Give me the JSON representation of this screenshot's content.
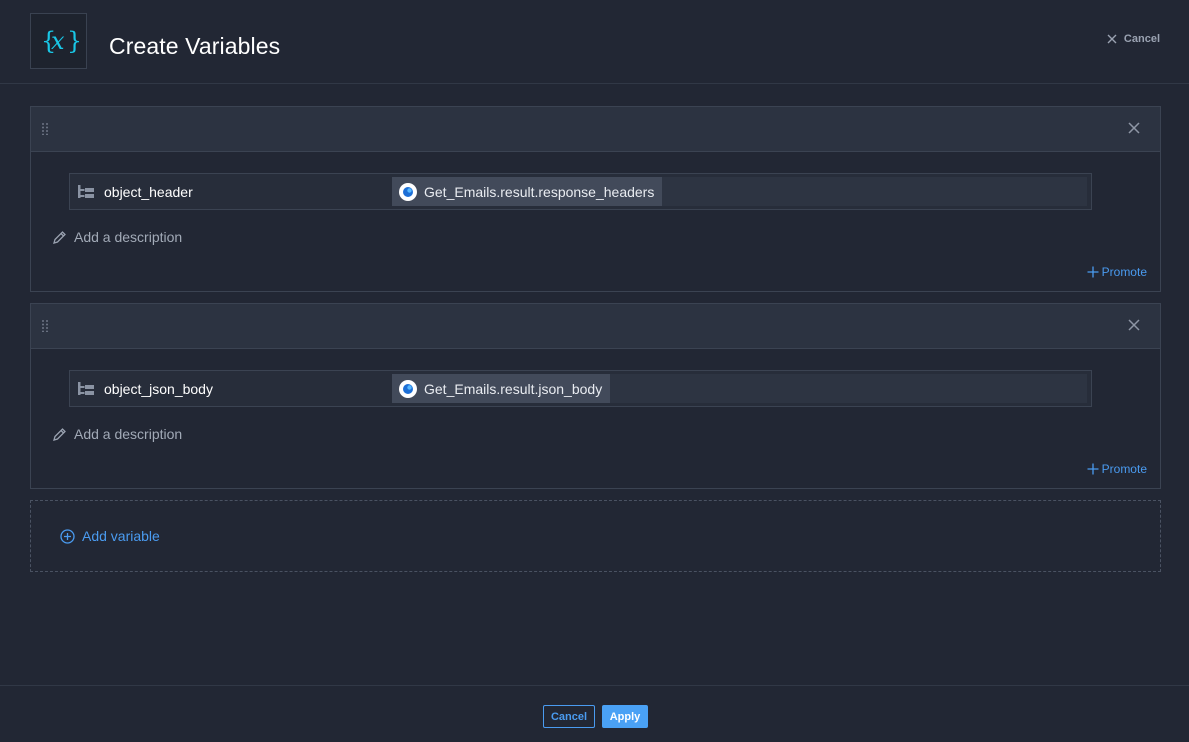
{
  "header": {
    "title": "Create Variables",
    "cancel_label": "Cancel",
    "logo_icon": "curly-braces-x-icon"
  },
  "variables": [
    {
      "name": "object_header",
      "value": "Get_Emails.result.response_headers",
      "description_placeholder": "Add a description",
      "promote_label": "Promote"
    },
    {
      "name": "object_json_body",
      "value": "Get_Emails.result.json_body",
      "description_placeholder": "Add a description",
      "promote_label": "Promote"
    }
  ],
  "add_variable_label": "Add variable",
  "footer": {
    "cancel_label": "Cancel",
    "apply_label": "Apply"
  },
  "colors": {
    "background": "#222734",
    "accent": "#4a9bf0",
    "logo": "#19c7e6"
  }
}
